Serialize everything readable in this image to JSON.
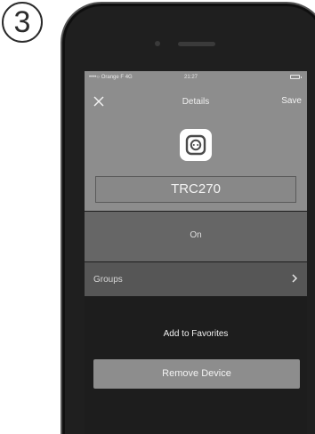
{
  "step_number": "3",
  "status_bar": {
    "carrier": "••••○ Orange F  4G",
    "time": "21:27"
  },
  "nav": {
    "close_icon": "close-icon",
    "title": "Details",
    "save_label": "Save"
  },
  "device": {
    "icon": "power-socket-icon",
    "name": "TRC270"
  },
  "state": {
    "label": "On"
  },
  "groups": {
    "label": "Groups",
    "chevron_icon": "chevron-right-icon"
  },
  "favorites": {
    "label": "Add to Favorites"
  },
  "remove": {
    "label": "Remove Device"
  },
  "colors": {
    "header_bg": "#8d8d8d",
    "state_row_bg": "#666666",
    "groups_row_bg": "#565656",
    "screen_bg": "#1d1d1d",
    "button_bg": "#8d8d8d"
  }
}
